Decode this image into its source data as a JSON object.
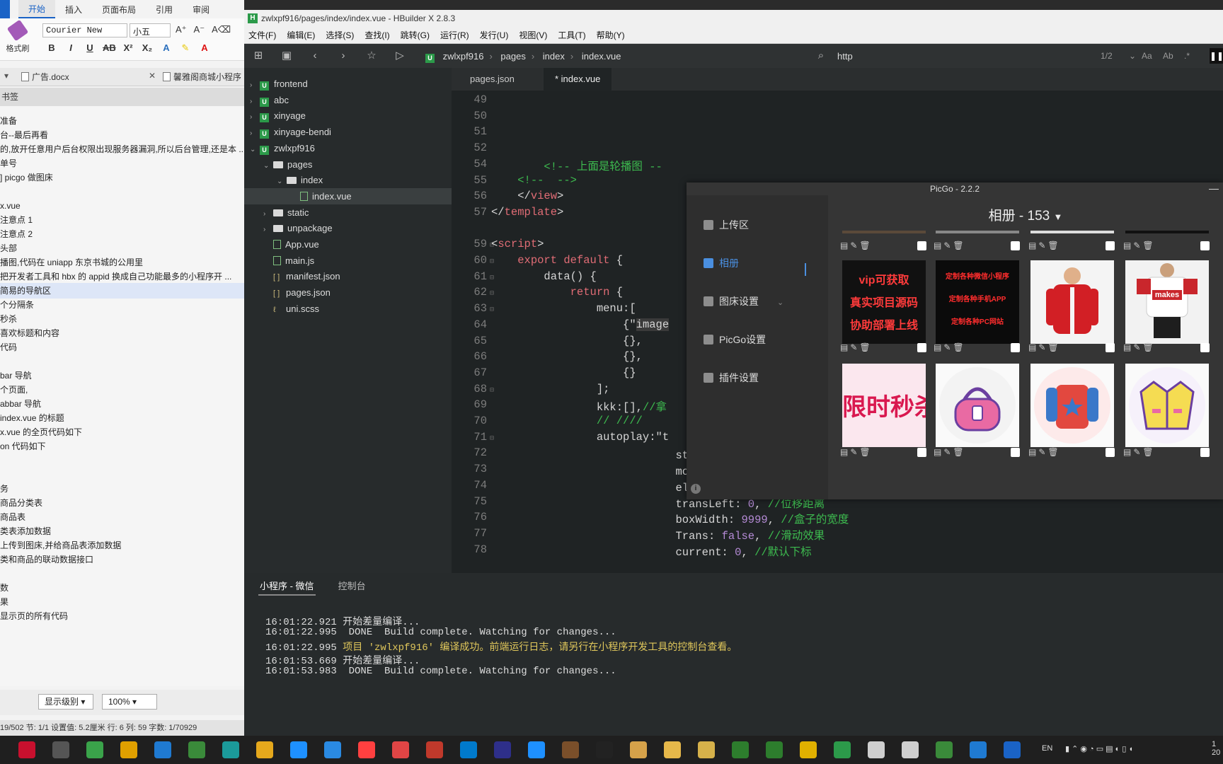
{
  "word": {
    "ribbon_tabs": [
      "开始",
      "插入",
      "页面布局",
      "引用",
      "审阅"
    ],
    "format_brush": "格式刷",
    "font_name": "Courier New",
    "font_size": "小五",
    "doc_tabs": [
      "广告.docx",
      "馨雅阁商城小程序"
    ],
    "nav_head": "书签",
    "outline": [
      "准备",
      "台--最后再看",
      "的,放开任意用户后台权限出现服务器漏洞,所以后台管理,还是本 ...",
      "单号",
      "] picgo 做图床",
      "",
      "x.vue",
      "注意点 1",
      "注意点 2",
      "头部",
      "播图,代码在 uniapp 东京书城的公用里",
      "把开发者工具和 hbx 的 appid 换成自己功能最多的小程序开 ...",
      "简易的导航区",
      "个分隔条",
      "秒杀",
      "喜欢标题和内容",
      "代码",
      "",
      "bar 导航",
      "个页面,",
      "abbar 导航",
      "index.vue 的标题",
      "x.vue 的全页代码如下",
      "on 代码如下",
      "",
      "",
      "务",
      "商品分类表",
      "商品表",
      "类表添加数据",
      "上传到图床,并给商品表添加数据",
      "类和商品的联动数据接口",
      "",
      "数",
      "果",
      "显示页的所有代码"
    ],
    "selected_outline_index": 12,
    "level_label": "显示级别",
    "zoom": "100%",
    "status": "19/502  节: 1/1  设置值: 5.2厘米  行: 6  列: 59  字数: 1/70929"
  },
  "hbuilder": {
    "title": "zwlxpf916/pages/index/index.vue - HBuilder X 2.8.3",
    "menu": [
      "文件(F)",
      "编辑(E)",
      "选择(S)",
      "查找(I)",
      "跳转(G)",
      "运行(R)",
      "发行(U)",
      "视图(V)",
      "工具(T)",
      "帮助(Y)"
    ],
    "breadcrumb": [
      "zwlxpf916",
      "pages",
      "index",
      "index.vue"
    ],
    "search": "http",
    "match": "1/2",
    "tree": [
      {
        "label": "frontend",
        "kind": "project",
        "depth": 0,
        "expanded": false
      },
      {
        "label": "abc",
        "kind": "project",
        "depth": 0,
        "expanded": false
      },
      {
        "label": "xinyage",
        "kind": "project",
        "depth": 0,
        "expanded": false
      },
      {
        "label": "xinyage-bendi",
        "kind": "project",
        "depth": 0,
        "expanded": false
      },
      {
        "label": "zwlxpf916",
        "kind": "project",
        "depth": 0,
        "expanded": true
      },
      {
        "label": "pages",
        "kind": "folder",
        "depth": 1,
        "expanded": true
      },
      {
        "label": "index",
        "kind": "folder",
        "depth": 2,
        "expanded": true
      },
      {
        "label": "index.vue",
        "kind": "file",
        "depth": 3
      },
      {
        "label": "static",
        "kind": "folder",
        "depth": 1,
        "expanded": false
      },
      {
        "label": "unpackage",
        "kind": "folder",
        "depth": 1,
        "expanded": false
      },
      {
        "label": "App.vue",
        "kind": "file",
        "depth": 1
      },
      {
        "label": "main.js",
        "kind": "file",
        "depth": 1
      },
      {
        "label": "manifest.json",
        "kind": "json",
        "depth": 1
      },
      {
        "label": "pages.json",
        "kind": "json",
        "depth": 1
      },
      {
        "label": "uni.scss",
        "kind": "scss",
        "depth": 1
      }
    ],
    "tabs": [
      "pages.json",
      "* index.vue"
    ],
    "code_lines": [
      {
        "n": "49",
        "html": ""
      },
      {
        "n": "50",
        "html": ""
      },
      {
        "n": "51",
        "html": ""
      },
      {
        "n": "52",
        "html": ""
      },
      {
        "n": "54",
        "html": "        <span class='c-cm'>&lt;!-- 上面是轮播图 --</span>"
      },
      {
        "n": "55",
        "html": "    <span class='c-cm'>&lt;!--  --&gt;</span>"
      },
      {
        "n": "56",
        "html": "    &lt;/<span class='c-tag'>view</span>&gt;"
      },
      {
        "n": "57",
        "html": "&lt;/<span class='c-tag'>template</span>&gt;"
      },
      {
        "n": "",
        "html": ""
      },
      {
        "n": "59",
        "html": "&lt;<span class='c-tag'>script</span>&gt;"
      },
      {
        "n": "60",
        "html": "    <span class='c-kw'>export default</span> {"
      },
      {
        "n": "61",
        "html": "        data() {"
      },
      {
        "n": "62",
        "html": "            <span class='c-kw'>return</span> {"
      },
      {
        "n": "63",
        "html": "                menu:["
      },
      {
        "n": "64",
        "html": "                    {\"<span style='background:#3a3a3a'>image</span>"
      },
      {
        "n": "65",
        "html": "                    {},"
      },
      {
        "n": "66",
        "html": "                    {},"
      },
      {
        "n": "67",
        "html": "                    {}"
      },
      {
        "n": "68",
        "html": "                ];"
      },
      {
        "n": "69",
        "html": "                kkk:[],<span class='c-cm'>//拿</span>"
      },
      {
        "n": "70",
        "html": "                <span class='c-cm'>// ////</span>"
      },
      {
        "n": "71",
        "html": "                autoplay:\"t"
      },
      {
        "n": "72",
        "html": "                            startX: <span class='c-num'>0</span>, <span class='c-cm'>//触摸开始位置</span>"
      },
      {
        "n": "73",
        "html": "                            moveX: <span class='c-num'>0</span>, <span class='c-cm'>//移动的位置</span>"
      },
      {
        "n": "74",
        "html": "                            elementW: <span class='c-num'>0</span>, <span class='c-cm'>//元素的宽度</span>"
      },
      {
        "n": "75",
        "html": "                            transLeft: <span class='c-num'>0</span>, <span class='c-cm'>//位移距离</span>"
      },
      {
        "n": "76",
        "html": "                            boxWidth: <span class='c-num'>9999</span>, <span class='c-cm'>//盒子的宽度</span>"
      },
      {
        "n": "77",
        "html": "                            Trans: <span class='c-num'>false</span>, <span class='c-cm'>//滑动效果</span>"
      },
      {
        "n": "78",
        "html": "                            current: <span class='c-num'>0</span>, <span class='c-cm'>//默认下标</span>"
      }
    ],
    "console_tabs": [
      "小程序 - 微信",
      "控制台"
    ],
    "console_lines": [
      {
        "t": "16:01:22.921 ",
        "m": "开始差量编译...",
        "ok": false
      },
      {
        "t": "16:01:22.995 ",
        "m": " DONE  Build complete. Watching for changes...",
        "ok": false
      },
      {
        "t": "16:01:22.995 ",
        "m": "项目 'zwlxpf916' 编译成功。前端运行日志，请另行在小程序开发工具的控制台查看。",
        "ok": true
      },
      {
        "t": "16:01:53.669 ",
        "m": "开始差量编译...",
        "ok": false
      },
      {
        "t": "16:01:53.983 ",
        "m": " DONE  Build complete. Watching for changes...",
        "ok": false
      }
    ]
  },
  "picgo": {
    "title": "PicGo - 2.2.2",
    "nav": [
      "上传区",
      "相册",
      "图床设置",
      "PicGo设置",
      "插件设置"
    ],
    "album_title": "相册 - 153",
    "thumbs_row1": [
      {
        "bg": "#111111",
        "lines": [
          "vip可获取",
          "真实项目源码",
          "协助部署上线"
        ],
        "fg": "#ff3b3b"
      },
      {
        "bg": "#0b0b0b",
        "lines": [
          "定制各种微信小程序",
          "定制各种手机APP",
          "定制各种PC网站"
        ],
        "fg": "#ff2d2d"
      },
      {
        "bg": "#f4f4f4",
        "art": "jacket-red"
      },
      {
        "bg": "#f2f2f2",
        "art": "shirt-makes",
        "word": "makes"
      }
    ],
    "thumbs_row2": [
      {
        "bg": "#fbe7ee",
        "lines": [
          "限时秒杀"
        ],
        "fg": "#d9184f"
      },
      {
        "bg": "#fafafa",
        "art": "bag"
      },
      {
        "bg": "#fafafa",
        "art": "sweater"
      },
      {
        "bg": "#fafafa",
        "art": "coat"
      }
    ],
    "row_controls": "▤ ✎ 🗑"
  },
  "colors": {
    "accent": "#4a8fe0",
    "hb_green": "#2c9a4a",
    "comment": "#3dbb4f",
    "keyword": "#e06c75"
  }
}
